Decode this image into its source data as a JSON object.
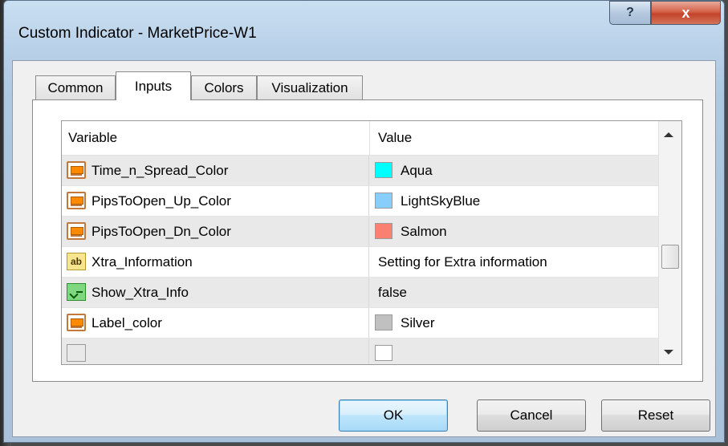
{
  "window": {
    "title": "Custom Indicator - MarketPrice-W1",
    "help_label": "?",
    "close_label": "x"
  },
  "tabs": [
    {
      "label": "Common",
      "active": false
    },
    {
      "label": "Inputs",
      "active": true
    },
    {
      "label": "Colors",
      "active": false
    },
    {
      "label": "Visualization",
      "active": false
    }
  ],
  "grid": {
    "columns": [
      "Variable",
      "Value"
    ],
    "rows": [
      {
        "icon": "color-input-icon",
        "variable": "Time_n_Spread_Color",
        "value": "Aqua",
        "swatch": "#00ffff"
      },
      {
        "icon": "color-input-icon",
        "variable": "PipsToOpen_Up_Color",
        "value": "LightSkyBlue",
        "swatch": "#87cefa"
      },
      {
        "icon": "color-input-icon",
        "variable": "PipsToOpen_Dn_Color",
        "value": "Salmon",
        "swatch": "#fa8072"
      },
      {
        "icon": "string-input-icon",
        "icon_text": "ab",
        "variable": "Xtra_Information",
        "value": "Setting for Extra information"
      },
      {
        "icon": "bool-input-icon",
        "variable": "Show_Xtra_Info",
        "value": "false"
      },
      {
        "icon": "color-input-icon",
        "variable": "Label_color",
        "value": "Silver",
        "swatch": "#c0c0c0"
      }
    ]
  },
  "buttons": {
    "ok": "OK",
    "cancel": "Cancel",
    "reset": "Reset"
  }
}
